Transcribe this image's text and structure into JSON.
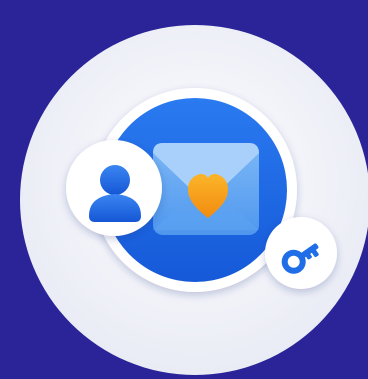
{
  "illustration": {
    "icons": [
      "envelope-icon",
      "heart-icon",
      "user-icon",
      "key-icon"
    ]
  },
  "colors": {
    "background": "#2b2498",
    "outer_disc": "#f1f2f8",
    "inner_ring": "#ffffff",
    "blue_disc": "#1c6ae8",
    "envelope_body": "#66aaf3",
    "envelope_flap": "#99c7f8",
    "heart": "#f9a01b",
    "badge_background": "#ffffff",
    "badge_icon": "#1f6ee8"
  }
}
